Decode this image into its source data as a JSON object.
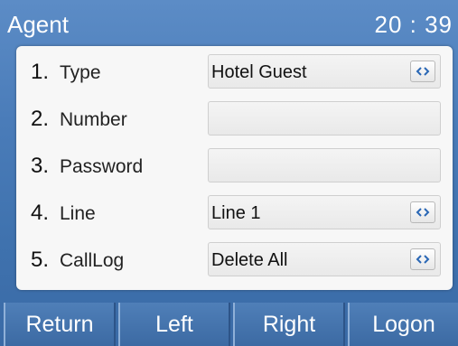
{
  "titlebar": {
    "title": "Agent",
    "clock": "20 : 39"
  },
  "form": {
    "rows": [
      {
        "num": "1.",
        "label": "Type",
        "value": "Hotel Guest",
        "has_switch": true
      },
      {
        "num": "2.",
        "label": "Number",
        "value": "",
        "has_switch": false
      },
      {
        "num": "3.",
        "label": "Password",
        "value": "",
        "has_switch": false
      },
      {
        "num": "4.",
        "label": "Line",
        "value": "Line 1",
        "has_switch": true
      },
      {
        "num": "5.",
        "label": "CallLog",
        "value": "Delete All",
        "has_switch": true
      }
    ],
    "switch_icon": "left-right-arrows-icon"
  },
  "softkeys": [
    "Return",
    "Left",
    "Right",
    "Logon"
  ],
  "colors": {
    "background": "#4a7cb9",
    "panel": "#f7f7f7",
    "switch_glyph": "#2a67b5",
    "softkey": "#3c6aa3"
  }
}
